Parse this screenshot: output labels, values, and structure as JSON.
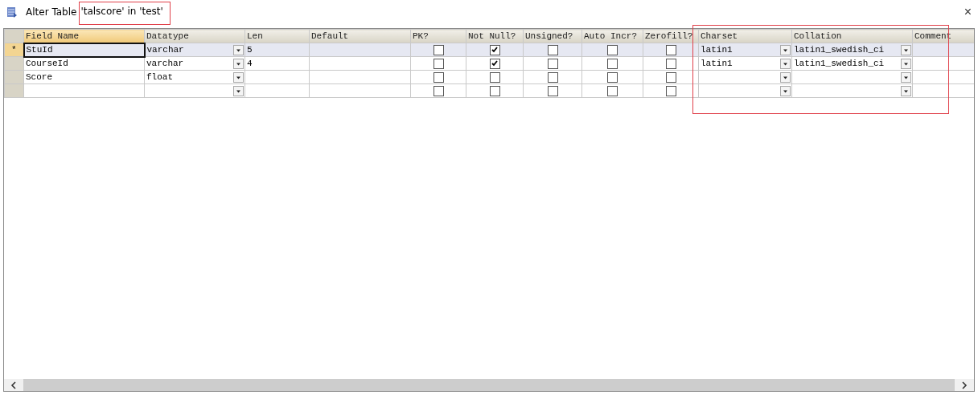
{
  "window": {
    "title": "Alter Table",
    "title_object": "'talscore' in 'test'",
    "close": "×"
  },
  "table": {
    "columns": [
      {
        "label": "Field Name",
        "kind": "text",
        "selected": true
      },
      {
        "label": "Datatype",
        "kind": "combo",
        "selected": false
      },
      {
        "label": "Len",
        "kind": "text",
        "selected": false
      },
      {
        "label": "Default",
        "kind": "text",
        "selected": false
      },
      {
        "label": "PK?",
        "kind": "check",
        "selected": false
      },
      {
        "label": "Not Null?",
        "kind": "check",
        "selected": false
      },
      {
        "label": "Unsigned?",
        "kind": "check",
        "selected": false
      },
      {
        "label": "Auto Incr?",
        "kind": "check",
        "selected": false
      },
      {
        "label": "Zerofill?",
        "kind": "check",
        "selected": false
      },
      {
        "label": "Charset",
        "kind": "combo",
        "selected": false
      },
      {
        "label": "Collation",
        "kind": "combo",
        "selected": false
      },
      {
        "label": "Comment",
        "kind": "text",
        "selected": false
      }
    ],
    "rows": [
      {
        "marker": "*",
        "selected": true,
        "cells": [
          {
            "text": "StuId"
          },
          {
            "text": "varchar"
          },
          {
            "text": "5"
          },
          {},
          {
            "checked": false
          },
          {
            "checked": true
          },
          {
            "checked": false
          },
          {
            "checked": false
          },
          {
            "checked": false
          },
          {
            "text": "latin1"
          },
          {
            "text": "latin1_swedish_ci"
          },
          {}
        ]
      },
      {
        "selected": false,
        "cells": [
          {
            "text": "CourseId"
          },
          {
            "text": "varchar"
          },
          {
            "text": "4"
          },
          {},
          {
            "checked": false
          },
          {
            "checked": true
          },
          {
            "checked": false
          },
          {
            "checked": false
          },
          {
            "checked": false
          },
          {
            "text": "latin1"
          },
          {
            "text": "latin1_swedish_ci"
          },
          {}
        ]
      },
      {
        "selected": false,
        "cells": [
          {
            "text": "Score"
          },
          {
            "text": "float"
          },
          {},
          {},
          {
            "checked": false
          },
          {
            "checked": false
          },
          {
            "checked": false
          },
          {
            "checked": false
          },
          {
            "checked": false
          },
          {},
          {},
          {}
        ]
      },
      {
        "selected": false,
        "cells": [
          {},
          {},
          {},
          {},
          {
            "checked": false
          },
          {
            "checked": false
          },
          {
            "checked": false
          },
          {
            "checked": false
          },
          {
            "checked": false
          },
          {},
          {},
          {}
        ]
      }
    ]
  },
  "annotations": {
    "title_box": true,
    "columns_box": true
  }
}
